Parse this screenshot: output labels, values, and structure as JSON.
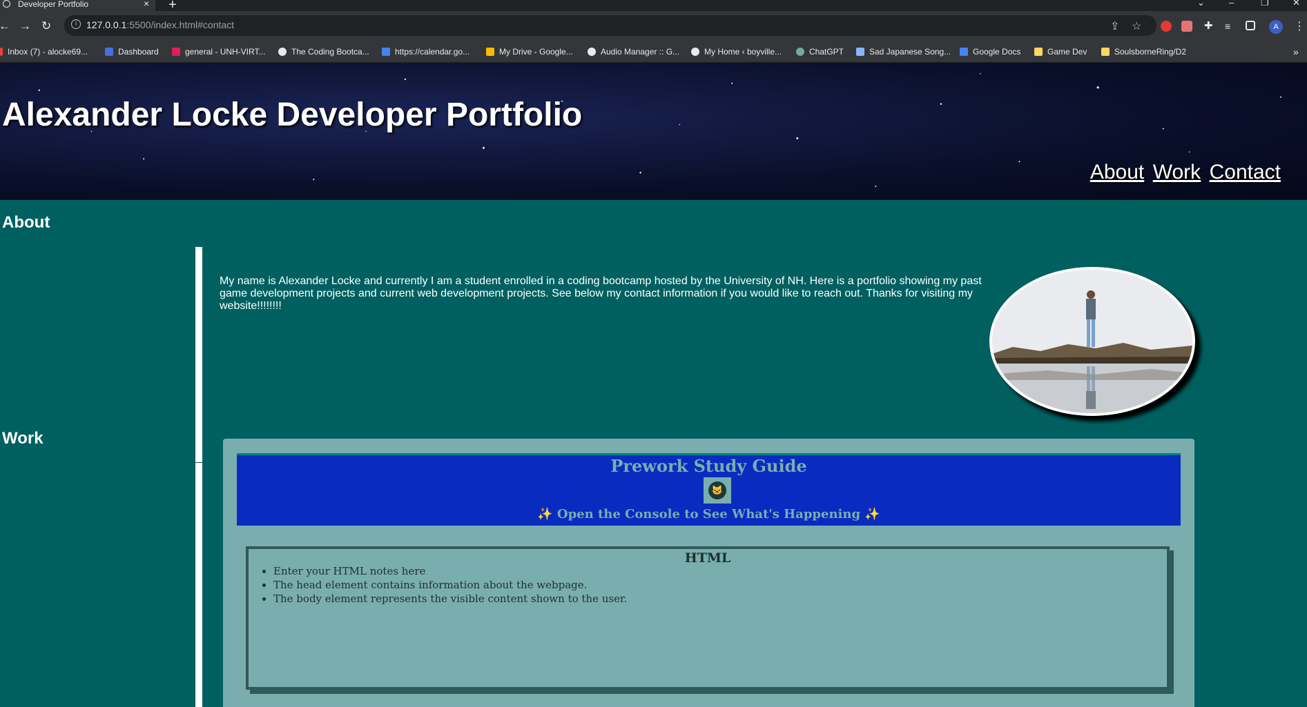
{
  "browser": {
    "tab_title": "Developer Portfolio",
    "url_host": "127.0.0.1",
    "url_path": ":5500/index.html#contact",
    "bookmarks": [
      {
        "label": "Inbox (7) - alocke69...",
        "color": "#ea4335"
      },
      {
        "label": "Dashboard",
        "color": "#4a6ee0"
      },
      {
        "label": "general - UNH-VIRT...",
        "color": "#e01e5a"
      },
      {
        "label": "The Coding Bootca...",
        "color": "#e8eaed"
      },
      {
        "label": "https://calendar.go...",
        "color": "#4285f4"
      },
      {
        "label": "My Drive - Google...",
        "color": "#fbbc04"
      },
      {
        "label": "Audio Manager :: G...",
        "color": "#e8eaed"
      },
      {
        "label": "My Home ‹ boyville...",
        "color": "#e8eaed"
      },
      {
        "label": "ChatGPT",
        "color": "#74aa9c"
      },
      {
        "label": "Sad Japanese Song...",
        "color": "#8ab4f8"
      },
      {
        "label": "Google Docs",
        "color": "#4285f4"
      },
      {
        "label": "Game Dev",
        "color": "#fdd663"
      },
      {
        "label": "SoulsborneRing/D2",
        "color": "#fdd663"
      }
    ]
  },
  "header": {
    "title": "Alexander Locke Developer Portfolio",
    "nav": [
      "About",
      "Work",
      "Contact"
    ]
  },
  "about": {
    "heading": "About",
    "text": "My name is Alexander Locke and currently I am a student enrolled in a coding bootcamp hosted by the University of NH. Here is a portfolio showing my past game development projects and current web development projects. See below my contact information if you would like to reach out. Thanks for visiting my website!!!!!!!!"
  },
  "work": {
    "heading": "Work",
    "card": {
      "title": "Prework Study Guide",
      "subtitle": "✨ Open the Console to See What's Happening ✨",
      "notes_heading": "HTML",
      "notes": [
        "Enter your HTML notes here",
        "The head element contains information about the webpage.",
        "The body element represents the visible content shown to the user."
      ]
    }
  },
  "colors": {
    "page_bg": "#006060",
    "banner_bg": "#0a2bc0",
    "card_bg": "#7aaeae"
  }
}
